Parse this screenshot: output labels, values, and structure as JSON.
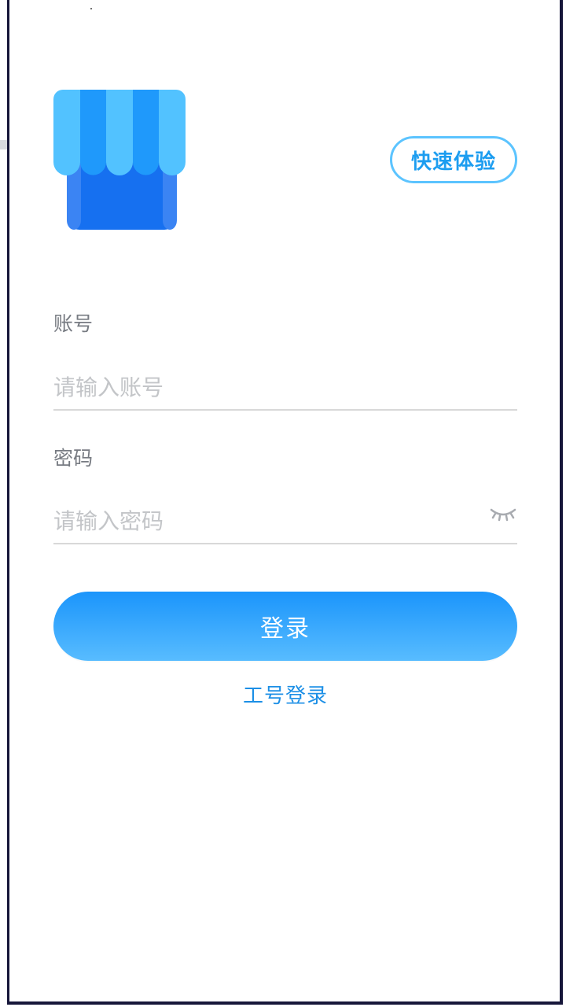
{
  "header": {
    "logo_icon": "shop-awning-icon",
    "quick_experience_label": "快速体验"
  },
  "form": {
    "account": {
      "label": "账号",
      "placeholder": "请输入账号",
      "value": ""
    },
    "password": {
      "label": "密码",
      "placeholder": "请输入密码",
      "value": "",
      "toggle_icon": "eye-closed-icon"
    }
  },
  "actions": {
    "login_label": "登录",
    "employee_login_label": "工号登录"
  },
  "colors": {
    "accent": "#1c9df0",
    "link": "#1c8fe6",
    "button_top": "#1b95fb",
    "button_bottom": "#58bcff",
    "logo_dark": "#1670f0",
    "logo_light": "#52c2ff"
  }
}
